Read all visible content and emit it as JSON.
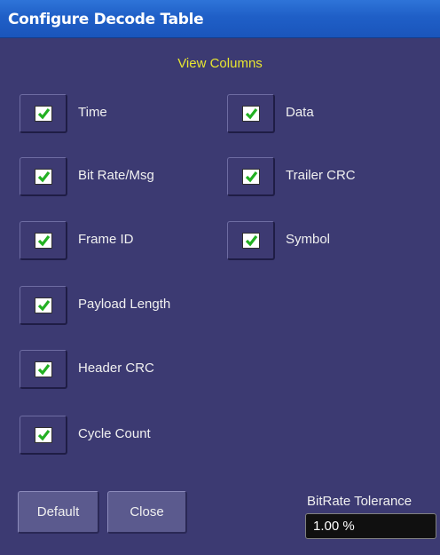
{
  "window": {
    "title": "Configure  Decode Table"
  },
  "section": {
    "title": "View Columns"
  },
  "columns_left": [
    {
      "label": "Time",
      "checked": true
    },
    {
      "label": "Bit Rate/Msg",
      "checked": true
    },
    {
      "label": "Frame ID",
      "checked": true
    },
    {
      "label": "Payload Length",
      "checked": true
    },
    {
      "label": "Header CRC",
      "checked": true
    },
    {
      "label": "Cycle Count",
      "checked": true
    }
  ],
  "columns_right": [
    {
      "label": "Data",
      "checked": true
    },
    {
      "label": "Trailer CRC",
      "checked": true
    },
    {
      "label": "Symbol",
      "checked": true
    }
  ],
  "buttons": {
    "default_label": "Default",
    "close_label": "Close"
  },
  "tolerance": {
    "label": "BitRate Tolerance",
    "value": "1.00 %"
  },
  "colors": {
    "background": "#3c3a72",
    "title_bar": "#1f5fc7",
    "section_title": "#e8e630",
    "check": "#22b022"
  },
  "icons": {
    "check": "checkmark-icon"
  }
}
